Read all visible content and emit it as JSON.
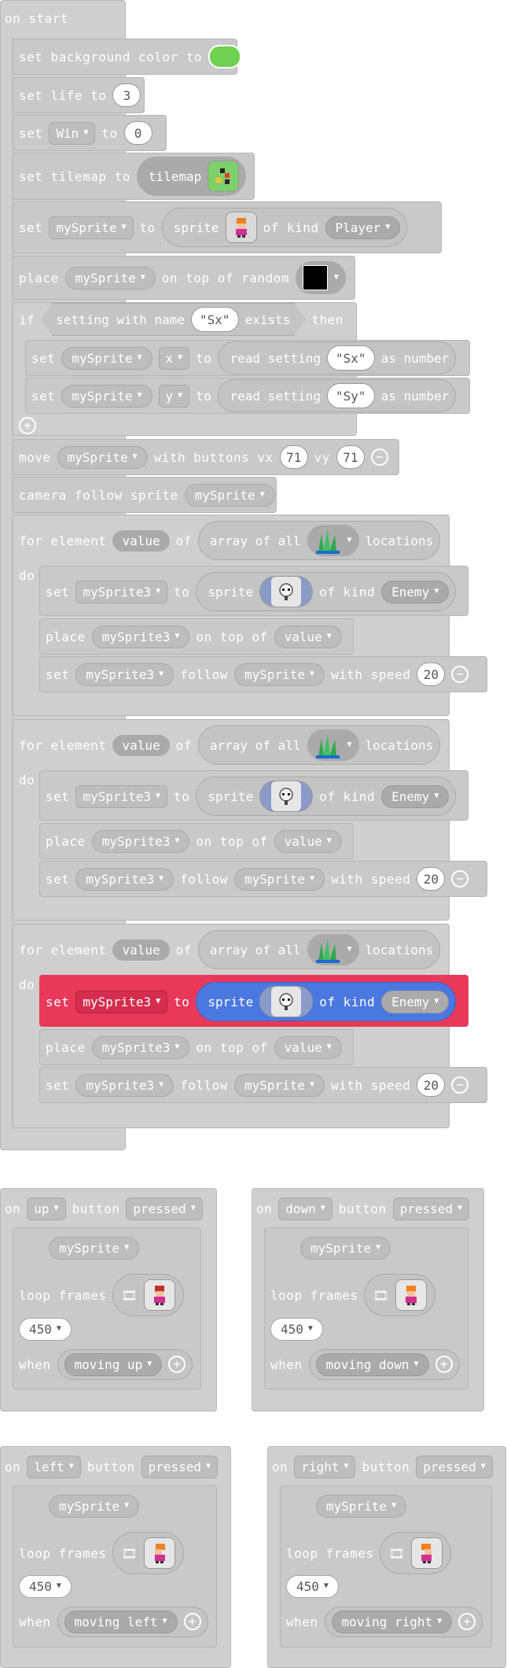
{
  "on_start": {
    "hat": "on start",
    "set_bg": {
      "label": "set background color to",
      "color": "#6fd14f"
    },
    "set_life": {
      "label": "set life to",
      "value": "3"
    },
    "set_win": {
      "set": "set",
      "var": "Win",
      "to": "to",
      "value": "0"
    },
    "set_tilemap": {
      "label": "set tilemap to",
      "tilemap": "tilemap"
    },
    "set_sprite": {
      "set": "set",
      "var": "mySprite",
      "to": "to",
      "sprite": "sprite",
      "of_kind": "of kind",
      "kind": "Player"
    },
    "place": {
      "place": "place",
      "var": "mySprite",
      "on_top": "on top of random"
    },
    "if": {
      "if": "if",
      "setting": "setting with name",
      "name": "\"Sx\"",
      "exists": "exists",
      "then": "then",
      "set_x": {
        "set": "set",
        "var": "mySprite",
        "prop": "x",
        "to": "to",
        "read": "read setting",
        "name": "\"Sx\"",
        "as": "as number"
      },
      "set_y": {
        "set": "set",
        "var": "mySprite",
        "prop": "y",
        "to": "to",
        "read": "read setting",
        "name": "\"Sy\"",
        "as": "as number"
      }
    },
    "move": {
      "move": "move",
      "var": "mySprite",
      "with": "with buttons vx",
      "vx": "71",
      "vy_label": "vy",
      "vy": "71"
    },
    "camera": {
      "label": "camera follow sprite",
      "var": "mySprite"
    },
    "loops": [
      {
        "for": "for element",
        "value": "value",
        "of": "of",
        "array": "array of all",
        "locations": "locations",
        "do": "do",
        "set": "set",
        "var": "mySprite3",
        "to": "to",
        "sprite": "sprite",
        "of_kind": "of kind",
        "kind": "Enemy",
        "place": "place",
        "on_top": "on top of",
        "pv": "value",
        "follow_set": "set",
        "follow": "follow",
        "target": "mySprite",
        "speed_label": "with speed",
        "speed": "20"
      },
      {
        "for": "for element",
        "value": "value",
        "of": "of",
        "array": "array of all",
        "locations": "locations",
        "do": "do",
        "set": "set",
        "var": "mySprite3",
        "to": "to",
        "sprite": "sprite",
        "of_kind": "of kind",
        "kind": "Enemy",
        "place": "place",
        "on_top": "on top of",
        "pv": "value",
        "follow_set": "set",
        "follow": "follow",
        "target": "mySprite",
        "speed_label": "with speed",
        "speed": "20"
      },
      {
        "for": "for element",
        "value": "value",
        "of": "of",
        "array": "array of all",
        "locations": "locations",
        "do": "do",
        "set": "set",
        "var": "mySprite3",
        "to": "to",
        "sprite": "sprite",
        "of_kind": "of kind",
        "kind": "Enemy",
        "place": "place",
        "on_top": "on top of",
        "pv": "value",
        "follow_set": "set",
        "follow": "follow",
        "target": "mySprite",
        "speed_label": "with speed",
        "speed": "20"
      }
    ]
  },
  "buttons": [
    {
      "on": "on",
      "button": "up",
      "button_label": "button",
      "event": "pressed",
      "sprite": "mySprite",
      "loop": "loop frames",
      "interval": "450",
      "when": "when",
      "state": "moving up"
    },
    {
      "on": "on",
      "button": "down",
      "button_label": "button",
      "event": "pressed",
      "sprite": "mySprite",
      "loop": "loop frames",
      "interval": "450",
      "when": "when",
      "state": "moving down"
    },
    {
      "on": "on",
      "button": "left",
      "button_label": "button",
      "event": "pressed",
      "sprite": "mySprite",
      "loop": "loop frames",
      "interval": "450",
      "when": "when",
      "state": "moving left"
    },
    {
      "on": "on",
      "button": "right",
      "button_label": "button",
      "event": "pressed",
      "sprite": "mySprite",
      "loop": "loop frames",
      "interval": "450",
      "when": "when",
      "state": "moving right"
    }
  ],
  "colors": {
    "block": "#c9c9c9",
    "highlight_stmt": "#e8395a",
    "highlight_reporter": "#4b78e0"
  }
}
